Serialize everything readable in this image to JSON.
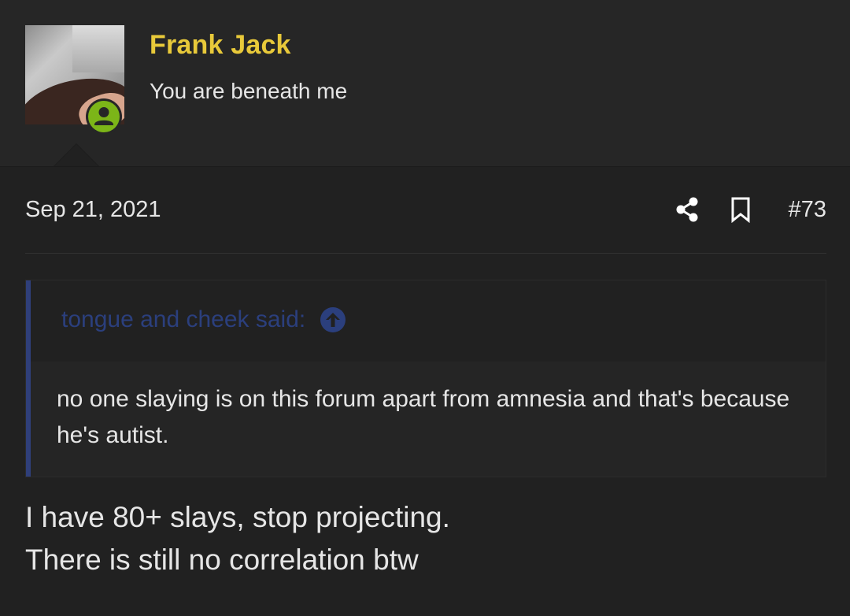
{
  "user": {
    "name": "Frank Jack",
    "title": "You are beneath me",
    "status_color": "#7cb518",
    "name_color": "#e8c93a"
  },
  "post": {
    "date": "Sep 21, 2021",
    "number": "#73",
    "actions": [
      {
        "icon": "share-icon"
      },
      {
        "icon": "bookmark-icon"
      }
    ]
  },
  "quote": {
    "author": "tongue and cheek said:",
    "author_color": "#2b3f7d",
    "jump_icon": "arrow-up-circle-icon",
    "text": "no one slaying is on this forum apart from amnesia and that's because he's autist."
  },
  "body": {
    "lines": [
      "I have 80+ slays, stop projecting.",
      "There is still no correlation btw"
    ]
  }
}
